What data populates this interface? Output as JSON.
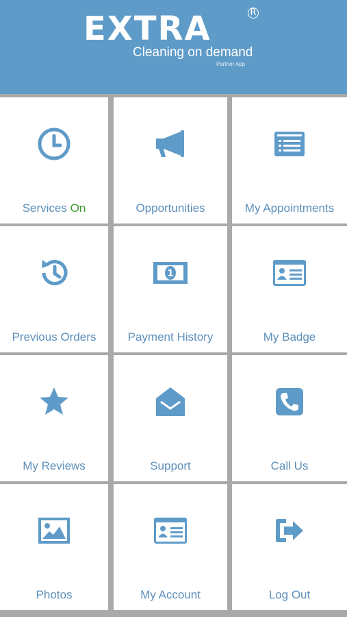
{
  "header": {
    "logo_text": "EXTRA",
    "registered_mark": "R",
    "tagline": "Cleaning on demand",
    "subtitle": "Partner App"
  },
  "colors": {
    "header_bg": "#5f9bc8",
    "icon": "#5f9bc8",
    "label": "#5d8fbb",
    "status_on": "#3a9a2e",
    "grid_gap": "#a9a9a9",
    "tile_bg": "#ffffff"
  },
  "tiles": [
    {
      "label": "Services",
      "status": "On",
      "icon": "clock-icon"
    },
    {
      "label": "Opportunities",
      "icon": "megaphone-icon"
    },
    {
      "label": "My Appointments",
      "icon": "list-icon"
    },
    {
      "label": "Previous Orders",
      "icon": "history-icon"
    },
    {
      "label": "Payment History",
      "icon": "money-bill-icon"
    },
    {
      "label": "My Badge",
      "icon": "id-card-icon"
    },
    {
      "label": "My Reviews",
      "icon": "star-icon"
    },
    {
      "label": "Support",
      "icon": "envelope-open-icon"
    },
    {
      "label": "Call Us",
      "icon": "phone-icon"
    },
    {
      "label": "Photos",
      "icon": "image-icon"
    },
    {
      "label": "My Account",
      "icon": "id-card-icon"
    },
    {
      "label": "Log Out",
      "icon": "sign-out-icon"
    }
  ]
}
